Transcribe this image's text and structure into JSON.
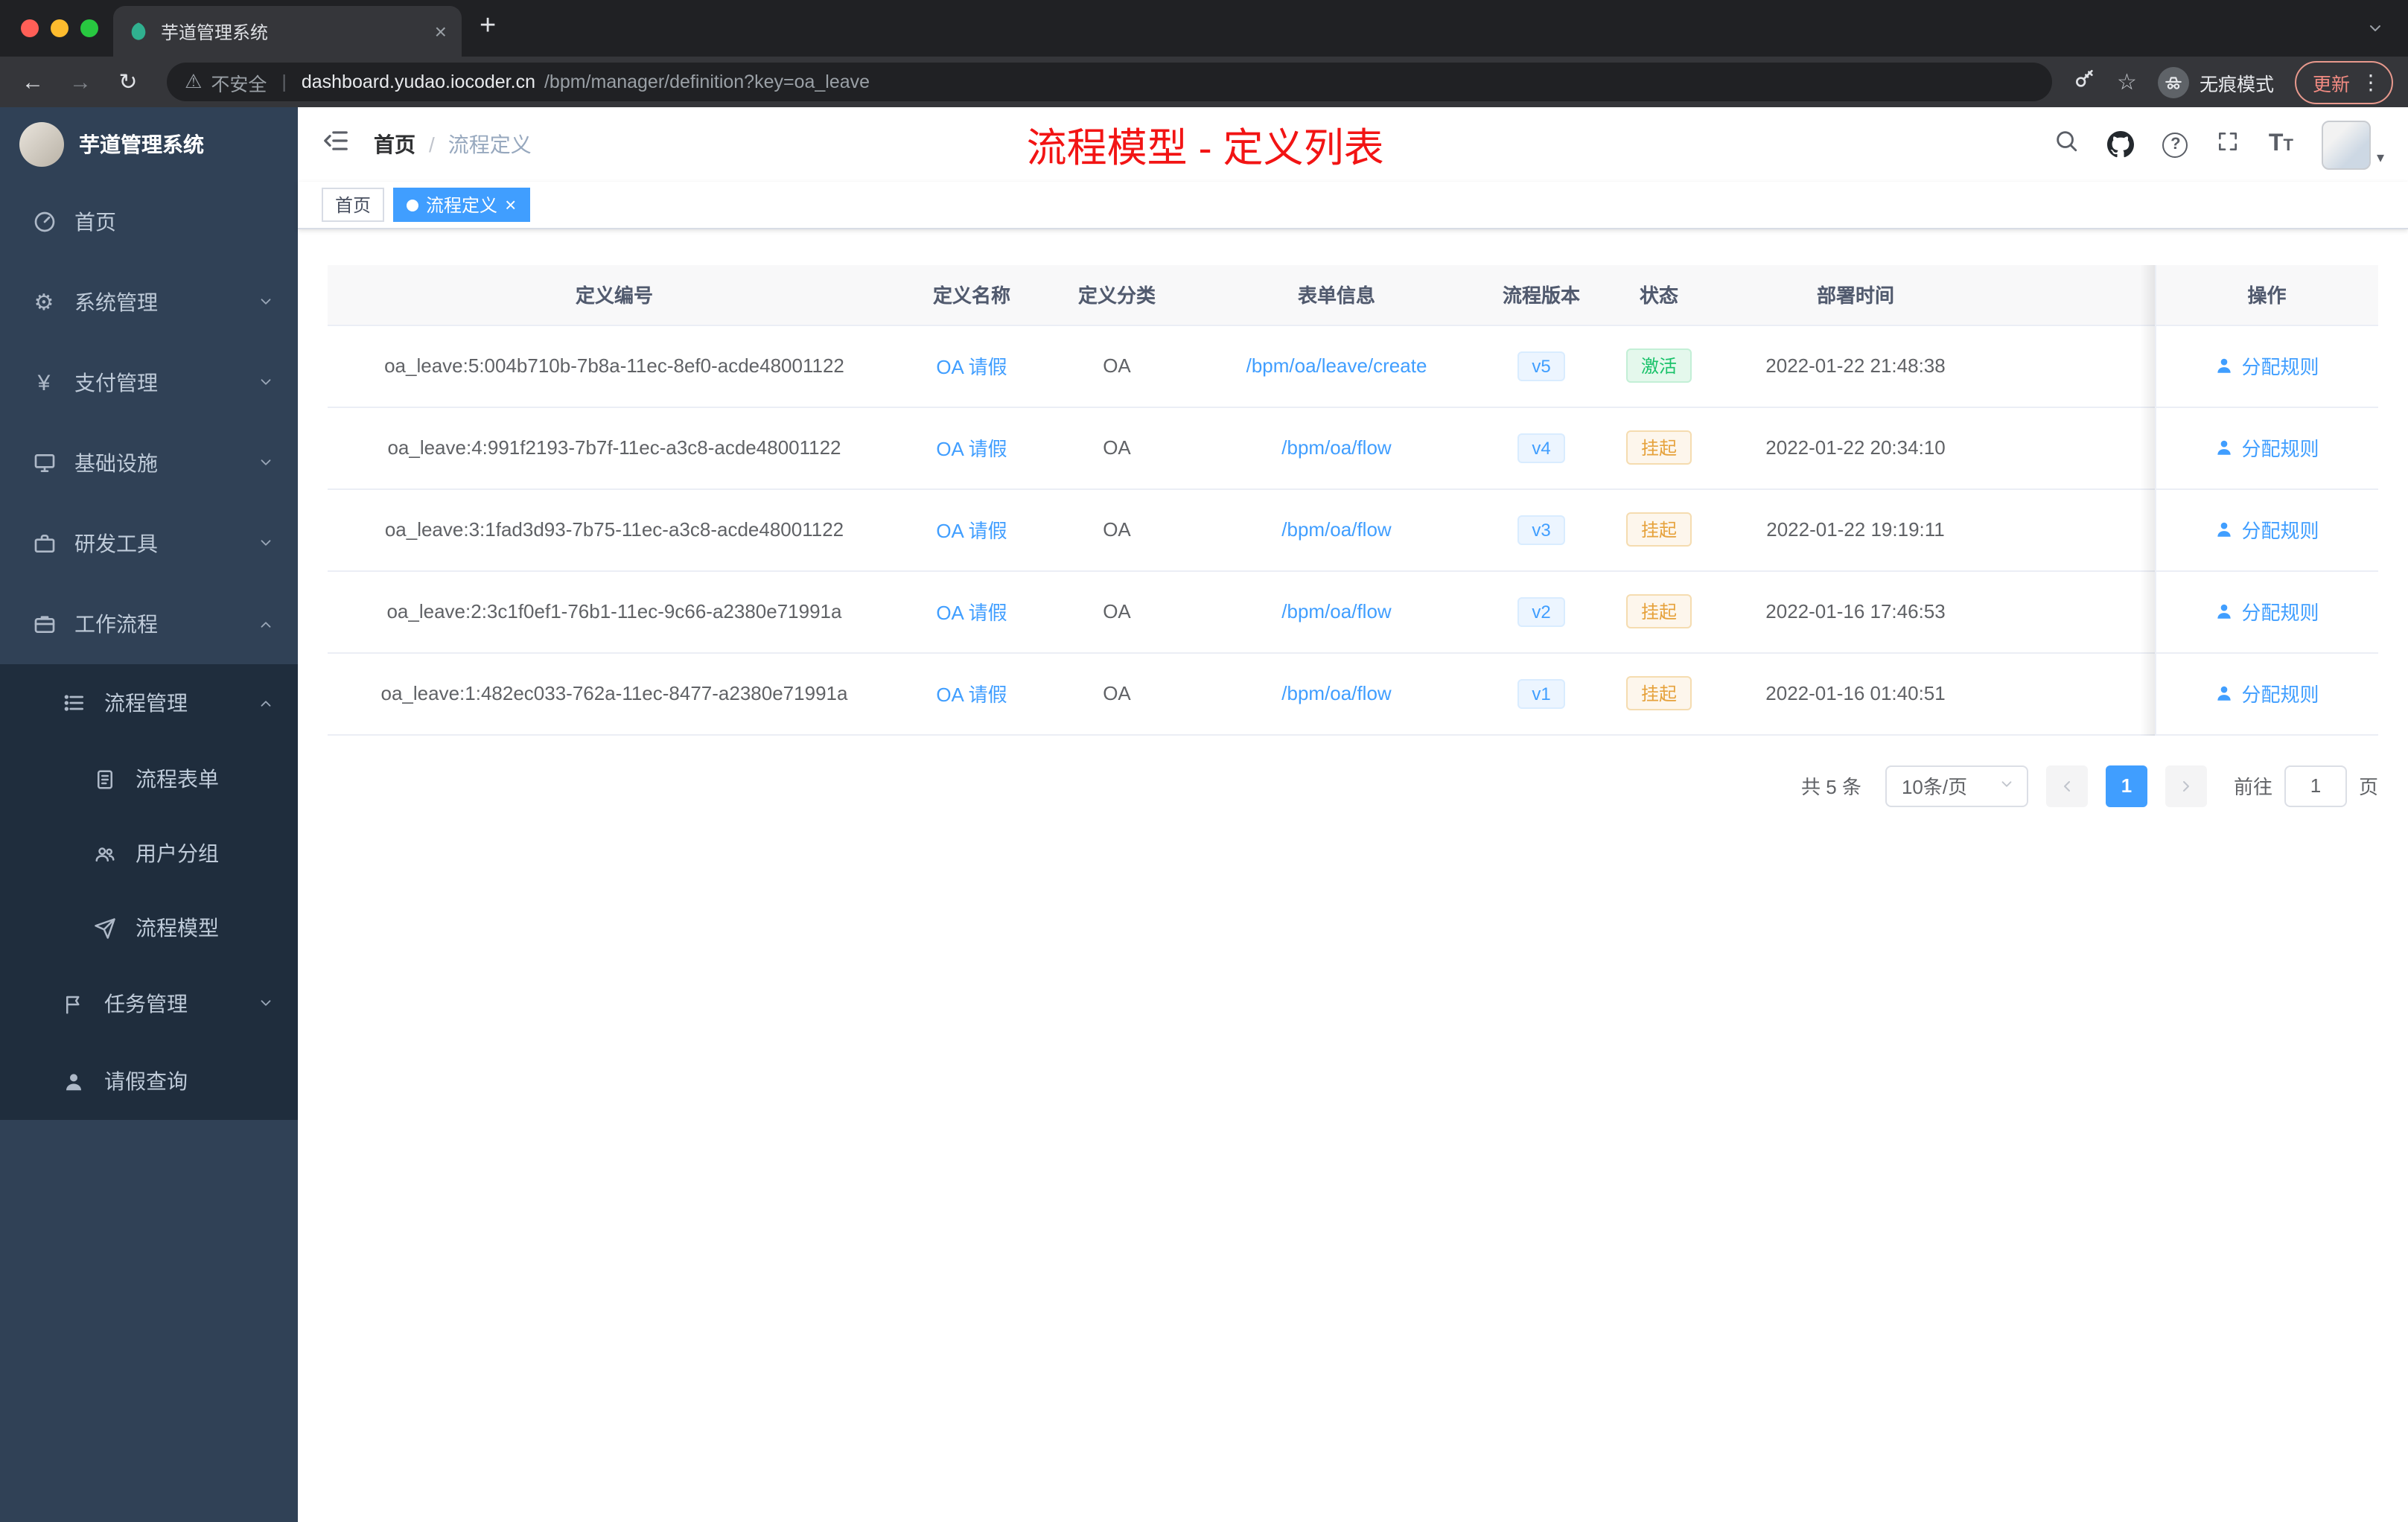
{
  "colors": {
    "primary": "#409eff",
    "title_red": "#f21414",
    "success": "#18c269",
    "warning": "#e6a23c"
  },
  "icons": {
    "close": "×",
    "plus": "+",
    "kebab": "⋮",
    "star": "☆",
    "warning": "⚠",
    "reload": "↻",
    "back": "←",
    "forward": "→",
    "caret_down": "▾",
    "question": "?",
    "divider": "|",
    "yen": "¥",
    "gear": "⚙",
    "font_size": "T"
  },
  "browser": {
    "tab": {
      "title": "芋道管理系统"
    },
    "address": {
      "security": "不安全",
      "host": "dashboard.yudao.iocoder.cn",
      "path": "/bpm/manager/definition?key=oa_leave"
    },
    "incognito": "无痕模式",
    "update": "更新"
  },
  "sidebar": {
    "title": "芋道管理系统",
    "items": [
      {
        "label": "首页"
      },
      {
        "label": "系统管理"
      },
      {
        "label": "支付管理"
      },
      {
        "label": "基础设施"
      },
      {
        "label": "研发工具"
      },
      {
        "label": "工作流程"
      }
    ],
    "workflow_children": {
      "process": {
        "label": "流程管理",
        "children": [
          {
            "label": "流程表单"
          },
          {
            "label": "用户分组"
          },
          {
            "label": "流程模型"
          }
        ]
      },
      "task": {
        "label": "任务管理"
      },
      "leave": {
        "label": "请假查询"
      }
    }
  },
  "header": {
    "breadcrumb_home": "首页",
    "breadcrumb_sep": "/",
    "breadcrumb_current": "流程定义",
    "title": "流程模型 - 定义列表"
  },
  "tags": [
    {
      "label": "首页"
    },
    {
      "label": "流程定义"
    }
  ],
  "table": {
    "columns": {
      "id": "定义编号",
      "name": "定义名称",
      "category": "定义分类",
      "form": "表单信息",
      "version": "流程版本",
      "status": "状态",
      "time": "部署时间",
      "ops": "操作"
    },
    "action_label": "分配规则",
    "rows": [
      {
        "id": "oa_leave:5:004b710b-7b8a-11ec-8ef0-acde48001122",
        "name": "OA 请假",
        "category": "OA",
        "form": "/bpm/oa/leave/create",
        "version": "v5",
        "status": "激活",
        "time": "2022-01-22 21:48:38"
      },
      {
        "id": "oa_leave:4:991f2193-7b7f-11ec-a3c8-acde48001122",
        "name": "OA 请假",
        "category": "OA",
        "form": "/bpm/oa/flow",
        "version": "v4",
        "status": "挂起",
        "time": "2022-01-22 20:34:10"
      },
      {
        "id": "oa_leave:3:1fad3d93-7b75-11ec-a3c8-acde48001122",
        "name": "OA 请假",
        "category": "OA",
        "form": "/bpm/oa/flow",
        "version": "v3",
        "status": "挂起",
        "time": "2022-01-22 19:19:11"
      },
      {
        "id": "oa_leave:2:3c1f0ef1-76b1-11ec-9c66-a2380e71991a",
        "name": "OA 请假",
        "category": "OA",
        "form": "/bpm/oa/flow",
        "version": "v2",
        "status": "挂起",
        "time": "2022-01-16 17:46:53"
      },
      {
        "id": "oa_leave:1:482ec033-762a-11ec-8477-a2380e71991a",
        "name": "OA 请假",
        "category": "OA",
        "form": "/bpm/oa/flow",
        "version": "v1",
        "status": "挂起",
        "time": "2022-01-16 01:40:51"
      }
    ]
  },
  "pagination": {
    "total": "共 5 条",
    "size": "10条/页",
    "page": "1",
    "goto": "前往",
    "goto_value": "1",
    "unit": "页"
  }
}
